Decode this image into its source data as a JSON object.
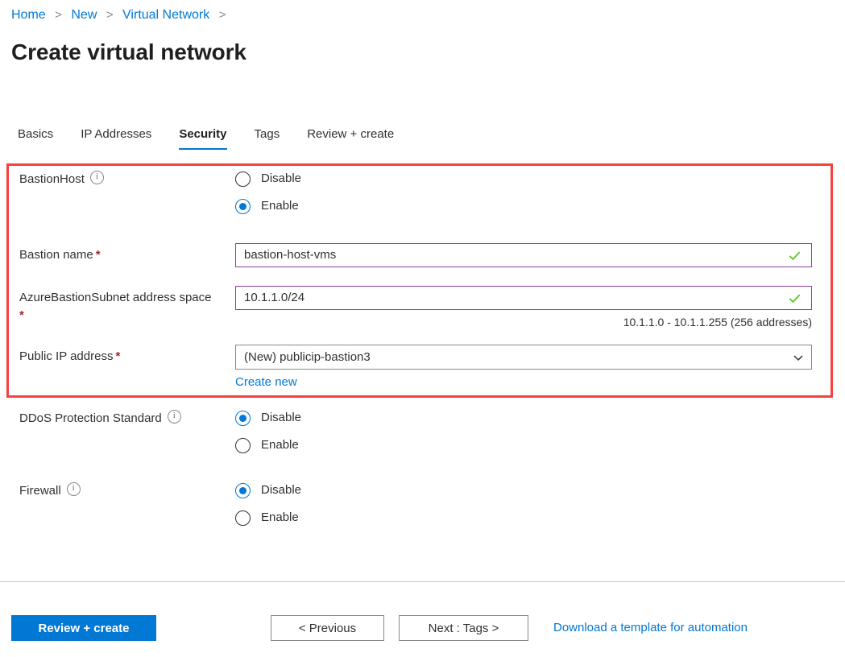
{
  "breadcrumb": {
    "items": [
      "Home",
      "New",
      "Virtual Network"
    ],
    "separator": ">"
  },
  "page_title": "Create virtual network",
  "tabs": [
    {
      "label": "Basics",
      "active": false
    },
    {
      "label": "IP Addresses",
      "active": false
    },
    {
      "label": "Security",
      "active": true
    },
    {
      "label": "Tags",
      "active": false
    },
    {
      "label": "Review + create",
      "active": false
    }
  ],
  "form": {
    "bastion_host": {
      "label": "BastionHost",
      "has_info": true,
      "options": [
        {
          "label": "Disable",
          "selected": false
        },
        {
          "label": "Enable",
          "selected": true
        }
      ]
    },
    "bastion_name": {
      "label": "Bastion name",
      "required_mark": "*",
      "value": "bastion-host-vms",
      "valid": true
    },
    "subnet_address_space": {
      "label": "AzureBastionSubnet address space",
      "required_mark": "*",
      "value": "10.1.1.0/24",
      "valid": true,
      "helper": "10.1.1.0 - 10.1.1.255 (256 addresses)"
    },
    "public_ip": {
      "label": "Public IP address",
      "required_mark": "*",
      "value": "(New) publicip-bastion3",
      "create_link": "Create new"
    },
    "ddos": {
      "label": "DDoS Protection Standard",
      "has_info": true,
      "options": [
        {
          "label": "Disable",
          "selected": true
        },
        {
          "label": "Enable",
          "selected": false
        }
      ]
    },
    "firewall": {
      "label": "Firewall",
      "has_info": true,
      "options": [
        {
          "label": "Disable",
          "selected": true
        },
        {
          "label": "Enable",
          "selected": false
        }
      ]
    }
  },
  "footer": {
    "review_create": "Review + create",
    "previous": "< Previous",
    "next": "Next : Tags >",
    "download_template": "Download a template for automation"
  },
  "colors": {
    "accent": "#0078d4",
    "highlight_box": "#f94040",
    "valid_border": "#8a3fa0",
    "valid_check": "#5ac81e",
    "required_asterisk": "#a4262c"
  }
}
